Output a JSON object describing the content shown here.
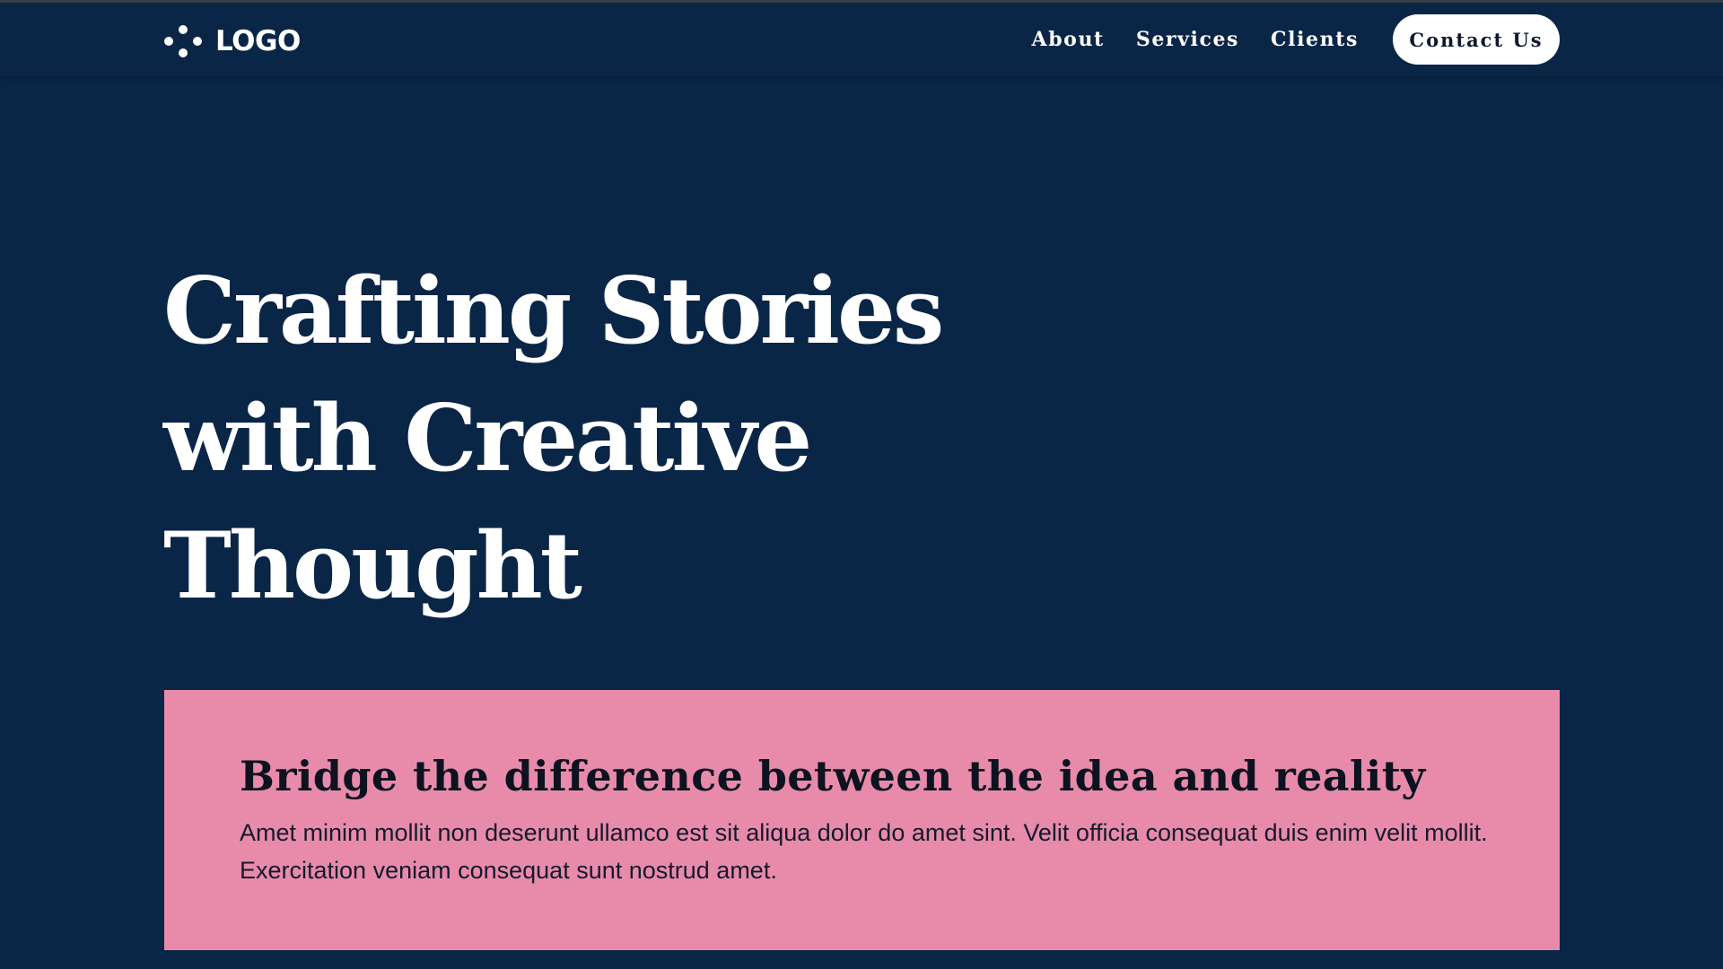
{
  "header": {
    "logo_text": "LOGO",
    "logo_icon": "four-dots-logo-icon",
    "nav_links": [
      {
        "label": "About"
      },
      {
        "label": "Services"
      },
      {
        "label": "Clients"
      }
    ],
    "contact_label": "Contact Us"
  },
  "hero": {
    "title_lines": [
      "Crafting Stories",
      "with Creative",
      "Thought"
    ]
  },
  "card": {
    "title": "Bridge the difference between the idea and reality",
    "body": "Amet minim mollit non deserunt ullamco est sit aliqua dolor do amet sint. Velit officia consequat duis enim velit mollit. Exercitation veniam consequat sunt nostrud amet."
  },
  "colors": {
    "background": "#0a2647",
    "accent_card": "#e88bab",
    "button_bg": "#ffffff",
    "text_primary": "#ffffff",
    "text_dark": "#0c1220"
  }
}
